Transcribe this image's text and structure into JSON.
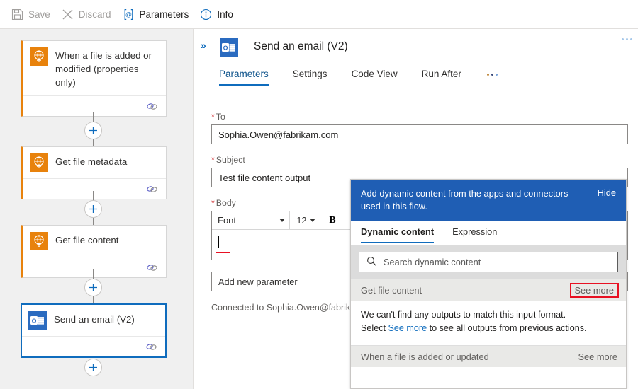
{
  "toolbar": {
    "items": [
      {
        "label": "Save",
        "icon": "save-icon",
        "enabled": false
      },
      {
        "label": "Discard",
        "icon": "discard-icon",
        "enabled": false
      },
      {
        "label": "Parameters",
        "icon": "parameters-icon",
        "enabled": true
      },
      {
        "label": "Info",
        "icon": "info-icon",
        "enabled": true
      }
    ]
  },
  "canvas": {
    "cards": [
      {
        "title": "When a file is added or modified (properties only)",
        "icon": "sharepoint-icon",
        "selected": false
      },
      {
        "title": "Get file metadata",
        "icon": "sharepoint-icon",
        "selected": false
      },
      {
        "title": "Get file content",
        "icon": "sharepoint-icon",
        "selected": false
      },
      {
        "title": "Send an email (V2)",
        "icon": "outlook-icon",
        "selected": true
      }
    ],
    "add_step_label": "+"
  },
  "pane": {
    "title": "Send an email (V2)",
    "icon": "outlook-icon",
    "collapse_label": "»",
    "tabs": [
      {
        "label": "Parameters",
        "active": true
      },
      {
        "label": "Settings",
        "active": false
      },
      {
        "label": "Code View",
        "active": false
      },
      {
        "label": "Run After",
        "active": false
      }
    ],
    "overflow_label": "···"
  },
  "form": {
    "to": {
      "label": "To",
      "required": true,
      "value": "Sophia.Owen@fabrikam.com"
    },
    "subject": {
      "label": "Subject",
      "required": true,
      "value": "Test file content output"
    },
    "body": {
      "label": "Body",
      "required": true,
      "value": ""
    },
    "editor": {
      "font_label": "Font",
      "size_label": "12",
      "bold_label": "B"
    },
    "add_parameter_label": "Add new parameter",
    "connection_text": "Connected to Sophia.Owen@fabrikam.com."
  },
  "dynamic_content": {
    "header_text": "Add dynamic content from the apps and connectors used in this flow.",
    "hide_label": "Hide",
    "tabs": [
      {
        "label": "Dynamic content",
        "active": true
      },
      {
        "label": "Expression",
        "active": false
      }
    ],
    "search_placeholder": "Search dynamic content",
    "groups": [
      {
        "name": "Get file content",
        "see_more_label": "See more",
        "highlighted": true
      },
      {
        "name": "When a file is added or updated",
        "see_more_label": "See more",
        "highlighted": false
      }
    ],
    "message": {
      "line1": "We can't find any outputs to match this input format.",
      "line2_prefix": "Select ",
      "line2_link": "See more",
      "line2_suffix": " to see all outputs from previous actions."
    }
  },
  "colors": {
    "accent_blue": "#0f6cbd",
    "header_blue": "#1f5eb4",
    "sharepoint_orange": "#e8820c",
    "outlook_blue": "#2a6bc0",
    "required_red": "#d13438",
    "highlight_red": "#e81123",
    "canvas_gray": "#f0f0f0"
  }
}
